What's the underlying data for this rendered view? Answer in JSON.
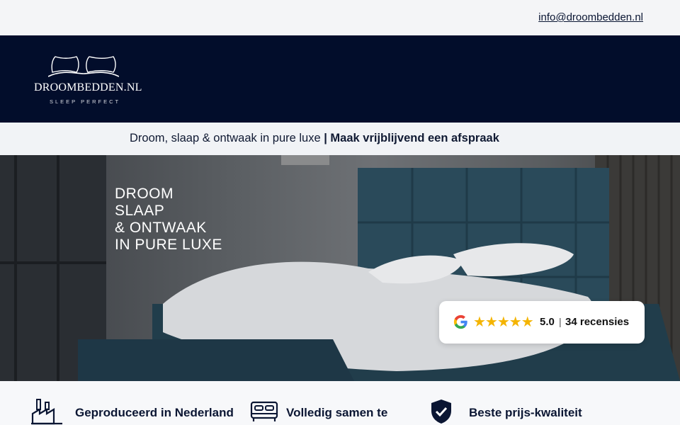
{
  "topbar": {
    "email": "info@droombedden.nl"
  },
  "header": {
    "logo_name": "DROOMBEDDEN.NL",
    "logo_tagline": "SLEEP PERFECT"
  },
  "strip": {
    "text": "Droom, slaap & ontwaak in pure luxe ",
    "cta": "| Maak vrijblijvend een afspraak"
  },
  "hero": {
    "slogan_lines": [
      "DROOM",
      "SLAAP",
      "& ONTWAAK",
      "IN PURE LUXE"
    ]
  },
  "review": {
    "stars": "★★★★★",
    "score": "5.0",
    "separator": "|",
    "count": "34 recensies"
  },
  "usps": [
    {
      "label": "Geproduceerd in Nederland",
      "icon": "factory-icon"
    },
    {
      "label": "Volledig samen te",
      "icon": "bed-icon"
    },
    {
      "label": "Beste prijs-kwaliteit",
      "icon": "shield-check-icon"
    }
  ],
  "colors": {
    "navy": "#020d2b",
    "star": "#f4b400"
  }
}
